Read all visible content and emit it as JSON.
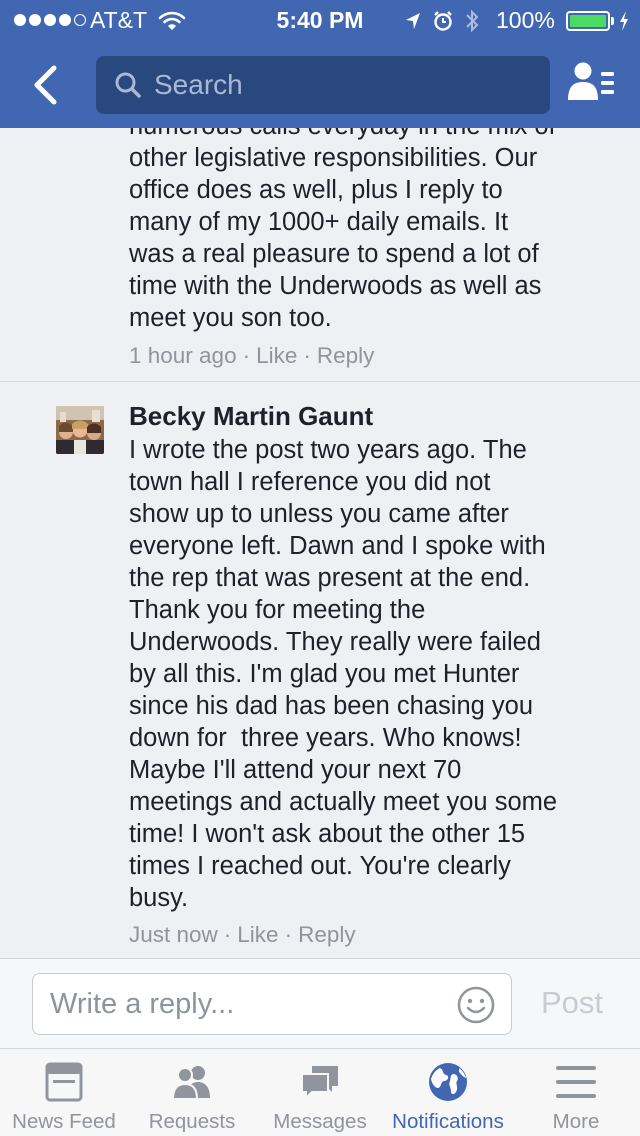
{
  "status_bar": {
    "carrier": "AT&T",
    "time": "5:40 PM",
    "battery_percent": "100%",
    "signal_bars": 4
  },
  "nav": {
    "search_placeholder": "Search"
  },
  "comments": [
    {
      "partial_first_line": "numerous calls everyday in the mix of",
      "lines": [
        "other legislative responsibilities. Our",
        "office does as well, plus I reply to",
        "many of my 1000+ daily emails. It",
        "was a real pleasure to spend a lot of",
        "time with the Underwoods as well as",
        "meet you son too."
      ],
      "time": "1 hour ago",
      "like": "Like",
      "reply": "Reply"
    },
    {
      "author": "Becky Martin Gaunt",
      "lines": [
        "I wrote the post two years ago. The",
        "town hall I reference you did not",
        "show up to unless you came after",
        "everyone left. Dawn and I spoke with",
        "the rep that was present at the end.",
        "Thank you for meeting the",
        "Underwoods. They really were failed",
        "by all this. I'm glad you met Hunter",
        "since his dad has been chasing you",
        "down for  three years. Who knows!",
        "Maybe I'll attend your next 70",
        "meetings and actually meet you some",
        "time! I won't ask about the other 15",
        "times I reached out. You're clearly",
        "busy."
      ],
      "time": "Just now",
      "like": "Like",
      "reply": "Reply"
    }
  ],
  "composer": {
    "placeholder": "Write a reply...",
    "post_label": "Post"
  },
  "tabs": [
    {
      "label": "News Feed",
      "icon": "news-feed-icon",
      "active": false
    },
    {
      "label": "Requests",
      "icon": "friend-requests-icon",
      "active": false
    },
    {
      "label": "Messages",
      "icon": "messages-icon",
      "active": false
    },
    {
      "label": "Notifications",
      "icon": "globe-icon",
      "active": true
    },
    {
      "label": "More",
      "icon": "menu-icon",
      "active": false
    }
  ],
  "colors": {
    "header": "#4267b2",
    "search_bg": "#29487d",
    "active_tab": "#4267b2",
    "inactive": "#90949c",
    "battery": "#4cd964"
  }
}
